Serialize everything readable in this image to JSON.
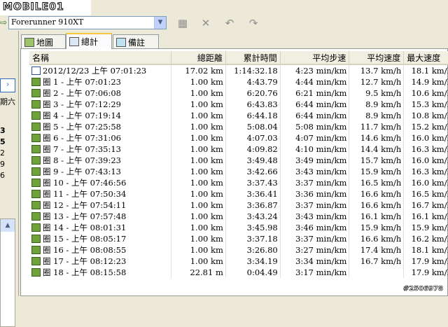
{
  "watermark": {
    "logo_text": "MOBILE01"
  },
  "toolbar": {
    "device_value": "Forerunner 910XT"
  },
  "leftpanel": {
    "weekday": "期六",
    "digits": [
      "3",
      "5",
      "2",
      "9",
      "6"
    ]
  },
  "tabs": [
    {
      "label": "地圖",
      "icon": "map-icon"
    },
    {
      "label": "總計",
      "icon": "totals-icon"
    },
    {
      "label": "備註",
      "icon": "notes-icon"
    }
  ],
  "columns": [
    "名稱",
    "總距離",
    "累計時間",
    "平均步速",
    "平均速度",
    "最大速度"
  ],
  "rows": [
    {
      "name": "2012/12/23 上午 07:01:23",
      "dist": "17.02 km",
      "time": "1:14:32.18",
      "pace": "4:23 min/km",
      "avg": "13.7 km/h",
      "max": "18.1 km/h",
      "icon": "run-activity-icon"
    },
    {
      "name": "圈 1 - 上午 07:01:23",
      "dist": "1.00 km",
      "time": "4:43.79",
      "pace": "4:44 min/km",
      "avg": "12.7 km/h",
      "max": "14.9 km/h",
      "icon": "lap-icon"
    },
    {
      "name": "圈 2 - 上午 07:06:08",
      "dist": "1.00 km",
      "time": "6:20.76",
      "pace": "6:21 min/km",
      "avg": "9.5 km/h",
      "max": "10.6 km/h",
      "icon": "lap-icon"
    },
    {
      "name": "圈 3 - 上午 07:12:29",
      "dist": "1.00 km",
      "time": "6:43.83",
      "pace": "6:44 min/km",
      "avg": "8.9 km/h",
      "max": "15.3 km/h",
      "icon": "lap-icon"
    },
    {
      "name": "圈 4 - 上午 07:19:14",
      "dist": "1.00 km",
      "time": "6:44.18",
      "pace": "6:44 min/km",
      "avg": "8.9 km/h",
      "max": "10.8 km/h",
      "icon": "lap-icon"
    },
    {
      "name": "圈 5 - 上午 07:25:58",
      "dist": "1.00 km",
      "time": "5:08.04",
      "pace": "5:08 min/km",
      "avg": "11.7 km/h",
      "max": "15.2 km/h",
      "icon": "lap-icon"
    },
    {
      "name": "圈 6 - 上午 07:31:06",
      "dist": "1.00 km",
      "time": "4:07.03",
      "pace": "4:07 min/km",
      "avg": "14.6 km/h",
      "max": "16.0 km/h",
      "icon": "lap-icon"
    },
    {
      "name": "圈 7 - 上午 07:35:13",
      "dist": "1.00 km",
      "time": "4:09.82",
      "pace": "4:10 min/km",
      "avg": "14.4 km/h",
      "max": "16.3 km/h",
      "icon": "lap-icon"
    },
    {
      "name": "圈 8 - 上午 07:39:23",
      "dist": "1.00 km",
      "time": "3:49.48",
      "pace": "3:49 min/km",
      "avg": "15.7 km/h",
      "max": "16.0 km/h",
      "icon": "lap-icon"
    },
    {
      "name": "圈 9 - 上午 07:43:13",
      "dist": "1.00 km",
      "time": "3:42.66",
      "pace": "3:43 min/km",
      "avg": "15.9 km/h",
      "max": "16.3 km/h",
      "icon": "lap-icon"
    },
    {
      "name": "圈 10 - 上午 07:46:56",
      "dist": "1.00 km",
      "time": "3:37.43",
      "pace": "3:37 min/km",
      "avg": "16.5 km/h",
      "max": "16.0 km/h",
      "icon": "lap-icon"
    },
    {
      "name": "圈 11 - 上午 07:50:34",
      "dist": "1.00 km",
      "time": "3:36.41",
      "pace": "3:36 min/km",
      "avg": "16.6 km/h",
      "max": "16.5 km/h",
      "icon": "lap-icon"
    },
    {
      "name": "圈 12 - 上午 07:54:11",
      "dist": "1.00 km",
      "time": "3:36.87",
      "pace": "3:37 min/km",
      "avg": "16.6 km/h",
      "max": "16.7 km/h",
      "icon": "lap-icon"
    },
    {
      "name": "圈 13 - 上午 07:57:48",
      "dist": "1.00 km",
      "time": "3:43.24",
      "pace": "3:43 min/km",
      "avg": "16.1 km/h",
      "max": "16.1 km/h",
      "icon": "lap-icon"
    },
    {
      "name": "圈 14 - 上午 08:01:31",
      "dist": "1.00 km",
      "time": "3:45.98",
      "pace": "3:46 min/km",
      "avg": "15.9 km/h",
      "max": "15.9 km/h",
      "icon": "lap-icon"
    },
    {
      "name": "圈 15 - 上午 08:05:17",
      "dist": "1.00 km",
      "time": "3:37.18",
      "pace": "3:37 min/km",
      "avg": "16.6 km/h",
      "max": "16.2 km/h",
      "icon": "lap-icon"
    },
    {
      "name": "圈 16 - 上午 08:08:55",
      "dist": "1.00 km",
      "time": "3:26.80",
      "pace": "3:27 min/km",
      "avg": "17.4 km/h",
      "max": "18.1 km/h",
      "icon": "lap-icon"
    },
    {
      "name": "圈 17 - 上午 08:12:23",
      "dist": "1.00 km",
      "time": "3:34.19",
      "pace": "3:34 min/km",
      "avg": "16.7 km/h",
      "max": "17.9 km/h",
      "icon": "lap-icon"
    },
    {
      "name": "圈 18 - 上午 08:15:58",
      "dist": "22.81 m",
      "time": "0:04.49",
      "pace": "3:17 min/km",
      "avg": "",
      "max": "17.9 km/h",
      "icon": "lap-icon"
    }
  ],
  "image_tag": "#2506978",
  "colors": {
    "accent": "#ffc83c",
    "lap_icon": "#6ea33b",
    "header_bg": "#f1efe2"
  }
}
